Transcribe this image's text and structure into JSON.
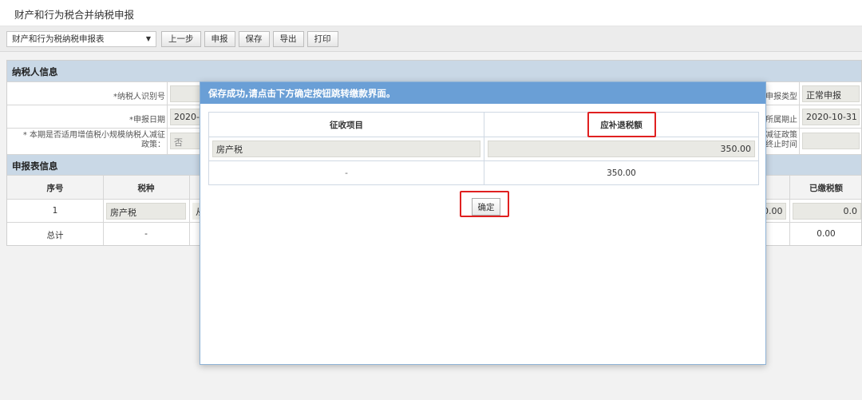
{
  "page_title": "财产和行为税合并纳税申报",
  "toolbar": {
    "select_value": "财产和行为税纳税申报表",
    "buttons": [
      "上一步",
      "申报",
      "保存",
      "导出",
      "打印"
    ]
  },
  "taxpayer_section": {
    "title": "纳税人信息",
    "taxpayer_id_label": "*纳税人识别号",
    "taxpayer_id_value": "",
    "declare_date_label": "*申报日期",
    "declare_date_value": "2020-1",
    "small_scale_label_line1": "* 本期是否适用增值税小规模纳税人减征",
    "small_scale_label_line2": "政策：",
    "small_scale_value": "否",
    "declare_type_label": "申报类型",
    "declare_type_value": "正常申报",
    "period_end_label": "所属期止",
    "period_end_value": "2020-10-31",
    "policy_end_label_line1": "减征政策",
    "policy_end_label_line2": "终止时间",
    "policy_end_value": ""
  },
  "declare_section": {
    "title": "申报表信息",
    "columns": {
      "seq": "序号",
      "tax_type": "税种",
      "paid": "已缴税额"
    },
    "row": {
      "seq": "1",
      "tax_type": "房产税",
      "partial": "从",
      "amount_partial": "0.00",
      "paid": "0.0"
    },
    "total": {
      "label": "总计",
      "tax_type": "-",
      "paid": "0.00"
    }
  },
  "modal": {
    "title": "保存成功,请点击下方确定按钮跳转缴款界面。",
    "headers": [
      "征收项目",
      "应补退税额"
    ],
    "rows": [
      {
        "item": "房产税",
        "amount": "350.00"
      },
      {
        "item": "-",
        "amount": "350.00"
      }
    ],
    "confirm_label": "确定"
  },
  "colors": {
    "highlight": "#e02020",
    "modal_title_bg": "#6a9fd6",
    "section_bg": "#c9d8e6"
  }
}
